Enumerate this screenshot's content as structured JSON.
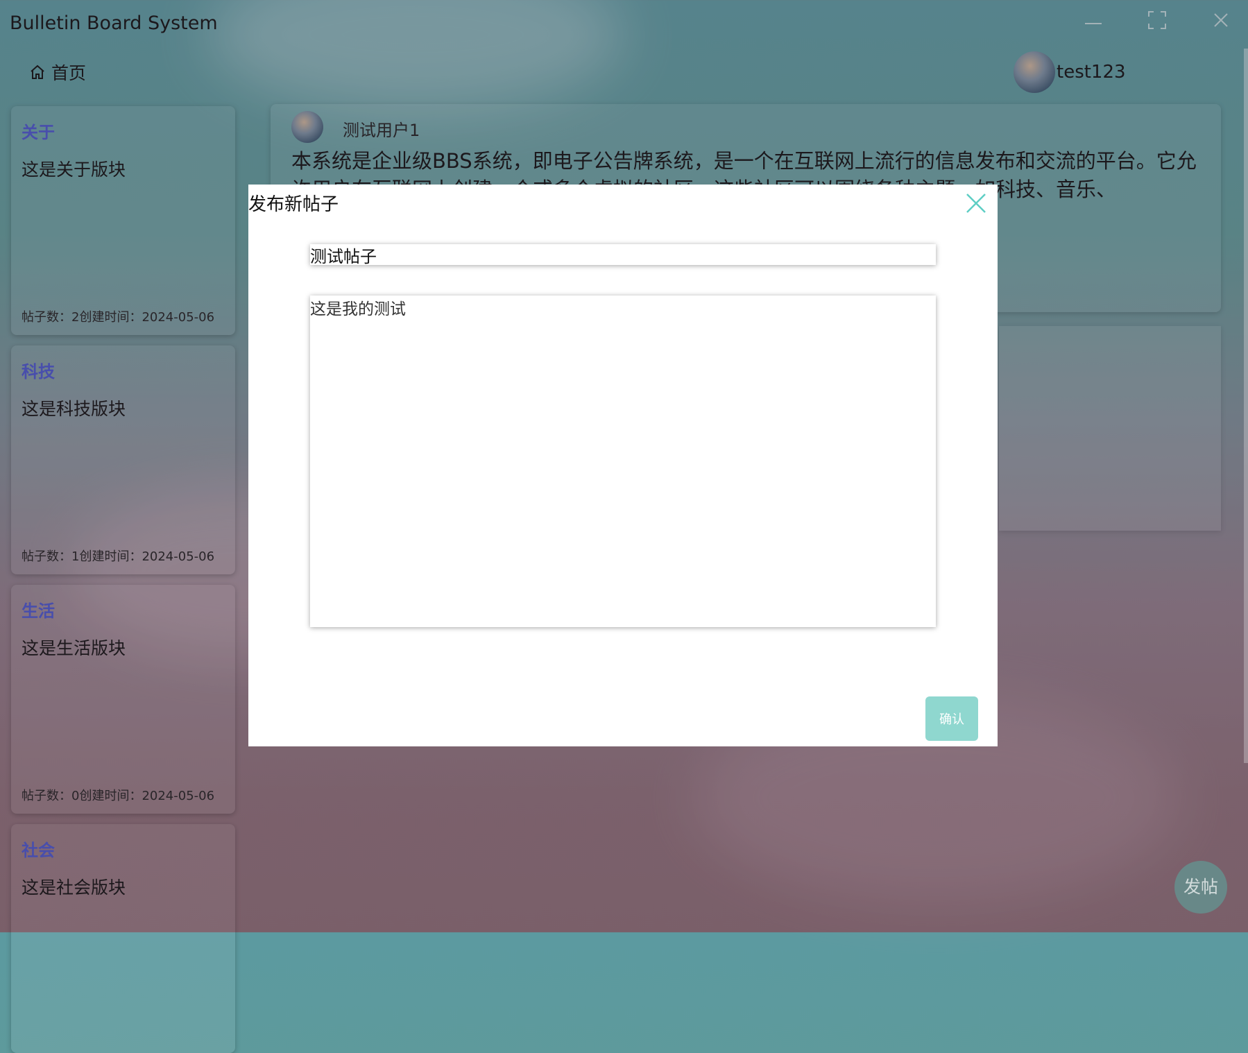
{
  "app": {
    "title": "Bulletin Board System"
  },
  "nav": {
    "home_label": "首页"
  },
  "user": {
    "name": "test123"
  },
  "sidebar": {
    "cards": [
      {
        "title": "关于",
        "desc": "这是关于版块",
        "meta": "帖子数：2创建时间：2024-05-06"
      },
      {
        "title": "科技",
        "desc": "这是科技版块",
        "meta": "帖子数：1创建时间：2024-05-06"
      },
      {
        "title": "生活",
        "desc": "这是生活版块",
        "meta": "帖子数：0创建时间：2024-05-06"
      },
      {
        "title": "社会",
        "desc": "这是社会版块"
      }
    ]
  },
  "post": {
    "author": "测试用户1",
    "body": "本系统是企业级BBS系统，即电子公告牌系统，是一个在互联网上流行的信息发布和交流的平台。它允许用户在互联网上创建一个或多个虚拟的社区，这些社区可以围绕各种主题，如科技、音乐、"
  },
  "modal": {
    "title": "发布新帖子",
    "title_value": "测试帖子",
    "content_value": "这是我的测试",
    "confirm_label": "确认"
  },
  "fab": {
    "label": "发帖"
  }
}
